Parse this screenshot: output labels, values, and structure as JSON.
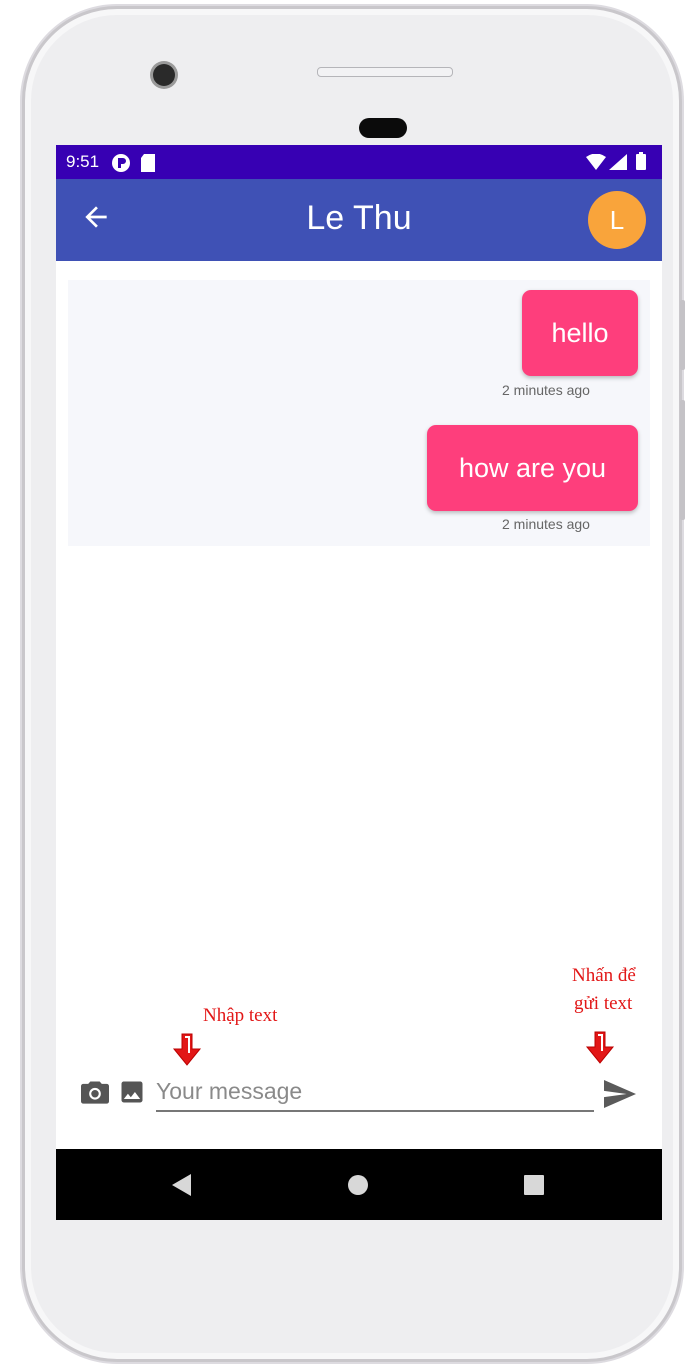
{
  "status": {
    "time": "9:51"
  },
  "appbar": {
    "title": "Le Thu",
    "avatar_letter": "L"
  },
  "messages": [
    {
      "text": "hello",
      "time": "2 minutes ago"
    },
    {
      "text": "how are you",
      "time": "2 minutes ago"
    }
  ],
  "composer": {
    "placeholder": "Your message",
    "value": ""
  },
  "annotations": {
    "input_hint": "Nhập text",
    "send_hint_line1": "Nhấn để",
    "send_hint_line2": "gửi text"
  },
  "colors": {
    "status_bar": "#3700b3",
    "app_bar": "#3f51b5",
    "bubble": "#fe3e7c",
    "avatar": "#f9a43b",
    "annotation": "#e21717"
  }
}
